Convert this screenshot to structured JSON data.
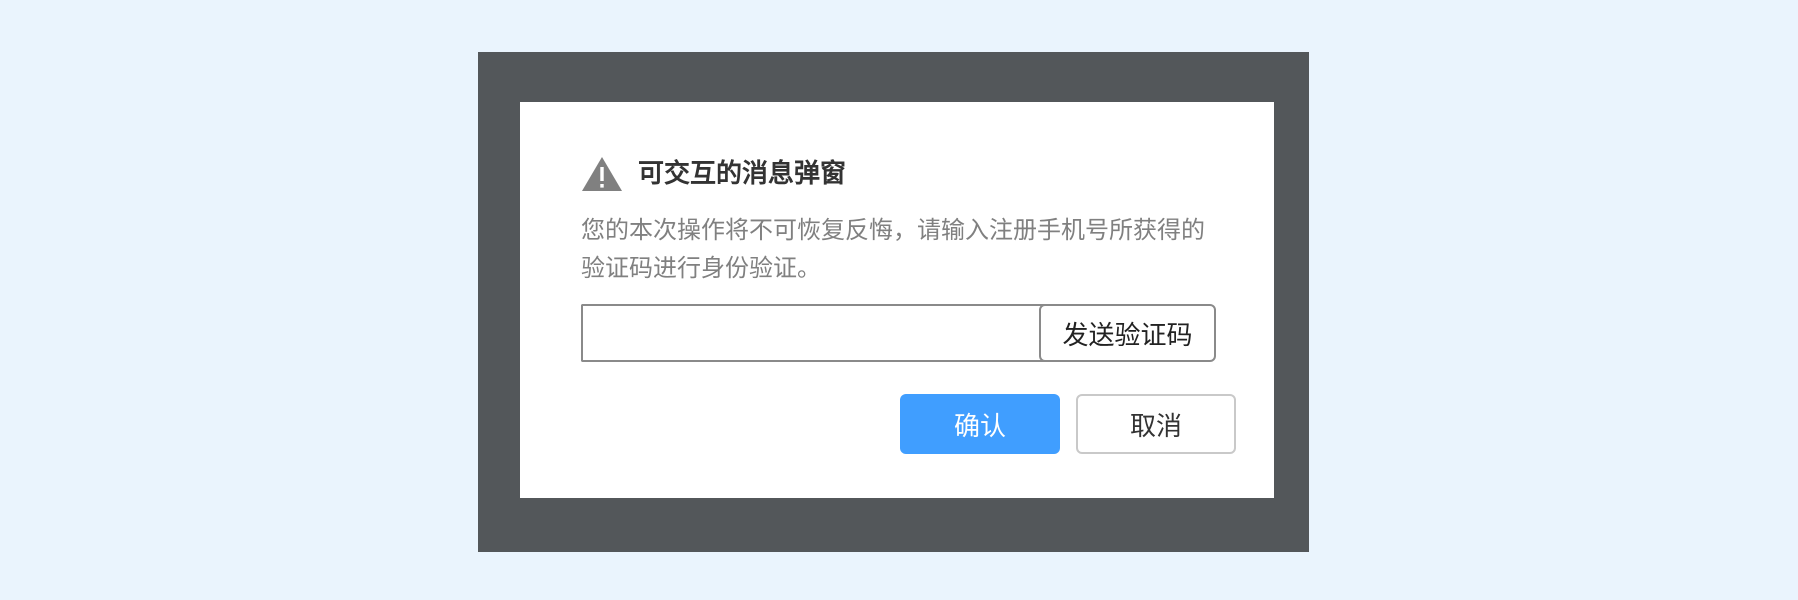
{
  "dialog": {
    "title": "可交互的消息弹窗",
    "icon": "warning-icon",
    "message": "您的本次操作将不可恢复反悔，请输入注册手机号所获得的验证码进行身份验证。",
    "code_input": {
      "value": "",
      "placeholder": ""
    },
    "send_code_label": "发送验证码",
    "confirm_label": "确认",
    "cancel_label": "取消"
  },
  "colors": {
    "page_background": "#eaf4fd",
    "overlay": "#53575a",
    "dialog_background": "#ffffff",
    "primary": "#409eff",
    "icon": "#808080"
  }
}
